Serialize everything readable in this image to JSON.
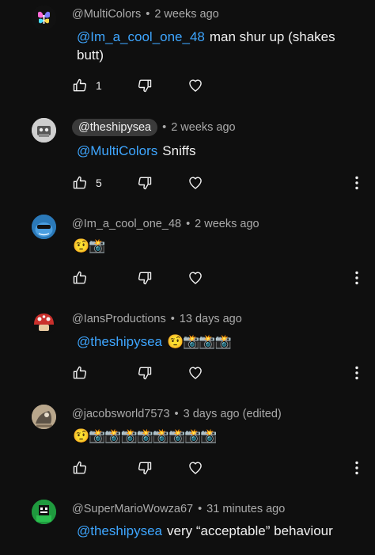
{
  "comments": [
    {
      "handle": "@MultiColors",
      "time": "2 weeks ago",
      "mention": "@Im_a_cool_one_48",
      "text": "man shur up (shakes butt)",
      "likes": "1"
    },
    {
      "handle": "@theshipysea",
      "time": "2 weeks ago",
      "mention": "@MultiColors",
      "text": "Sniffs",
      "likes": "5"
    },
    {
      "handle": "@Im_a_cool_one_48",
      "time": "2 weeks ago",
      "emojis": "🤨📸"
    },
    {
      "handle": "@IansProductions",
      "time": "13 days ago",
      "mention": "@theshipysea",
      "emojis": "🤨📸📸📸"
    },
    {
      "handle": "@jacobsworld7573",
      "time": "3 days ago (edited)",
      "emojis": "🤨📸📸📸📸📸📸📸📸"
    },
    {
      "handle": "@SuperMarioWowza67",
      "time": "31 minutes ago",
      "mention": "@theshipysea",
      "text": "very “acceptable” behaviour"
    }
  ],
  "meta_separator": "•",
  "icons": [
    "like-icon",
    "dislike-icon",
    "heart-icon",
    "more-vert-icon"
  ],
  "colors": {
    "background": "#0f0f0f",
    "mention": "#3ea6ff",
    "meta_text": "#aaaaaa",
    "text": "#f1f1f1",
    "creator_pill": "#3a3a3a"
  }
}
